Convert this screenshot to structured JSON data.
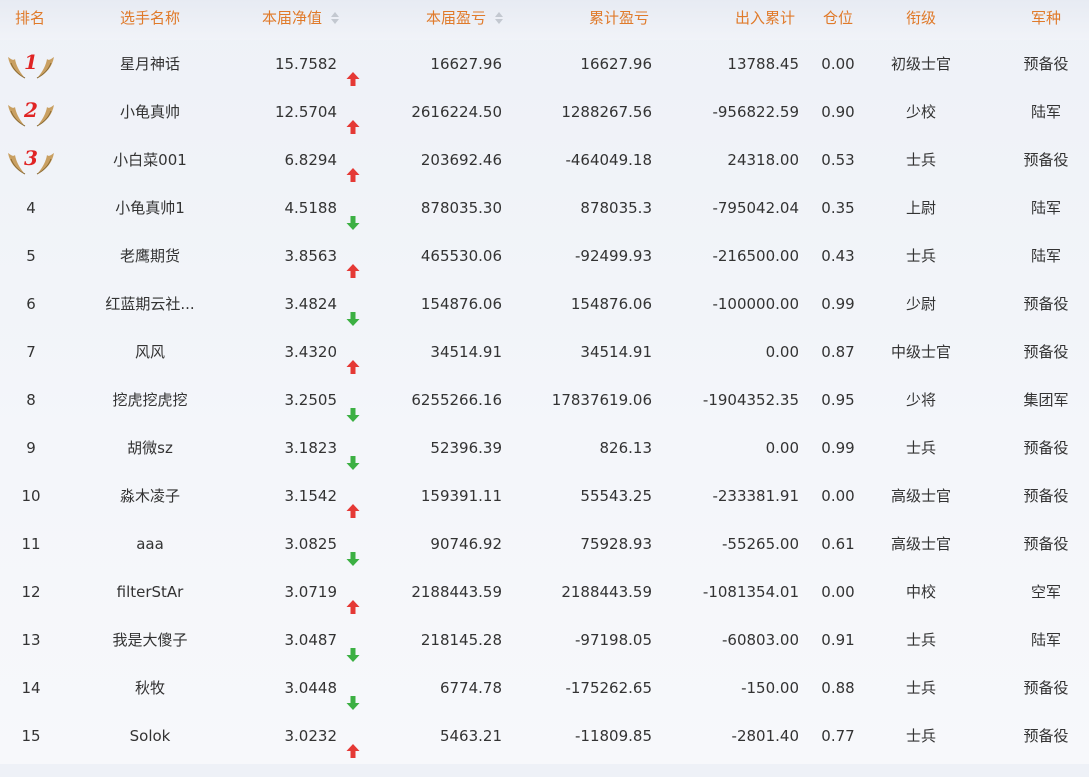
{
  "header": {
    "rank": "排名",
    "name": "选手名称",
    "nav": "本届净值",
    "pnl": "本届盈亏",
    "cum_pnl": "累计盈亏",
    "flow": "出入累计",
    "position": "仓位",
    "title": "衔级",
    "arm": "军种"
  },
  "colors": {
    "header_text": "#e07a2a",
    "up": "#e53935",
    "down": "#3cb043",
    "medal": "#c9a062"
  },
  "rows": [
    {
      "rank": "1",
      "medal": true,
      "name": "星月神话",
      "nav": "15.7582",
      "trend": "up",
      "pnl": "16627.96",
      "cum": "16627.96",
      "flow": "13788.45",
      "pos": "0.00",
      "title": "初级士官",
      "arm": "预备役"
    },
    {
      "rank": "2",
      "medal": true,
      "name": "小龟真帅",
      "nav": "12.5704",
      "trend": "up",
      "pnl": "2616224.50",
      "cum": "1288267.56",
      "flow": "-956822.59",
      "pos": "0.90",
      "title": "少校",
      "arm": "陆军"
    },
    {
      "rank": "3",
      "medal": true,
      "name": "小白菜001",
      "nav": "6.8294",
      "trend": "up",
      "pnl": "203692.46",
      "cum": "-464049.18",
      "flow": "24318.00",
      "pos": "0.53",
      "title": "士兵",
      "arm": "预备役"
    },
    {
      "rank": "4",
      "medal": false,
      "name": "小龟真帅1",
      "nav": "4.5188",
      "trend": "down",
      "pnl": "878035.30",
      "cum": "878035.3",
      "flow": "-795042.04",
      "pos": "0.35",
      "title": "上尉",
      "arm": "陆军"
    },
    {
      "rank": "5",
      "medal": false,
      "name": "老鹰期货",
      "nav": "3.8563",
      "trend": "up",
      "pnl": "465530.06",
      "cum": "-92499.93",
      "flow": "-216500.00",
      "pos": "0.43",
      "title": "士兵",
      "arm": "陆军"
    },
    {
      "rank": "6",
      "medal": false,
      "name": "红蓝期云社...",
      "nav": "3.4824",
      "trend": "down",
      "pnl": "154876.06",
      "cum": "154876.06",
      "flow": "-100000.00",
      "pos": "0.99",
      "title": "少尉",
      "arm": "预备役"
    },
    {
      "rank": "7",
      "medal": false,
      "name": "风风",
      "nav": "3.4320",
      "trend": "up",
      "pnl": "34514.91",
      "cum": "34514.91",
      "flow": "0.00",
      "pos": "0.87",
      "title": "中级士官",
      "arm": "预备役"
    },
    {
      "rank": "8",
      "medal": false,
      "name": "挖虎挖虎挖",
      "nav": "3.2505",
      "trend": "down",
      "pnl": "6255266.16",
      "cum": "17837619.06",
      "flow": "-1904352.35",
      "pos": "0.95",
      "title": "少将",
      "arm": "集团军"
    },
    {
      "rank": "9",
      "medal": false,
      "name": "胡微sz",
      "nav": "3.1823",
      "trend": "down",
      "pnl": "52396.39",
      "cum": "826.13",
      "flow": "0.00",
      "pos": "0.99",
      "title": "士兵",
      "arm": "预备役"
    },
    {
      "rank": "10",
      "medal": false,
      "name": "淼木凌子",
      "nav": "3.1542",
      "trend": "up",
      "pnl": "159391.11",
      "cum": "55543.25",
      "flow": "-233381.91",
      "pos": "0.00",
      "title": "高级士官",
      "arm": "预备役"
    },
    {
      "rank": "11",
      "medal": false,
      "name": "aaa",
      "nav": "3.0825",
      "trend": "down",
      "pnl": "90746.92",
      "cum": "75928.93",
      "flow": "-55265.00",
      "pos": "0.61",
      "title": "高级士官",
      "arm": "预备役"
    },
    {
      "rank": "12",
      "medal": false,
      "name": "filterStAr",
      "nav": "3.0719",
      "trend": "up",
      "pnl": "2188443.59",
      "cum": "2188443.59",
      "flow": "-1081354.01",
      "pos": "0.00",
      "title": "中校",
      "arm": "空军"
    },
    {
      "rank": "13",
      "medal": false,
      "name": "我是大傻子",
      "nav": "3.0487",
      "trend": "down",
      "pnl": "218145.28",
      "cum": "-97198.05",
      "flow": "-60803.00",
      "pos": "0.91",
      "title": "士兵",
      "arm": "陆军"
    },
    {
      "rank": "14",
      "medal": false,
      "name": "秋牧",
      "nav": "3.0448",
      "trend": "down",
      "pnl": "6774.78",
      "cum": "-175262.65",
      "flow": "-150.00",
      "pos": "0.88",
      "title": "士兵",
      "arm": "预备役"
    },
    {
      "rank": "15",
      "medal": false,
      "name": "Solok",
      "nav": "3.0232",
      "trend": "up",
      "pnl": "5463.21",
      "cum": "-11809.85",
      "flow": "-2801.40",
      "pos": "0.77",
      "title": "士兵",
      "arm": "预备役"
    }
  ]
}
